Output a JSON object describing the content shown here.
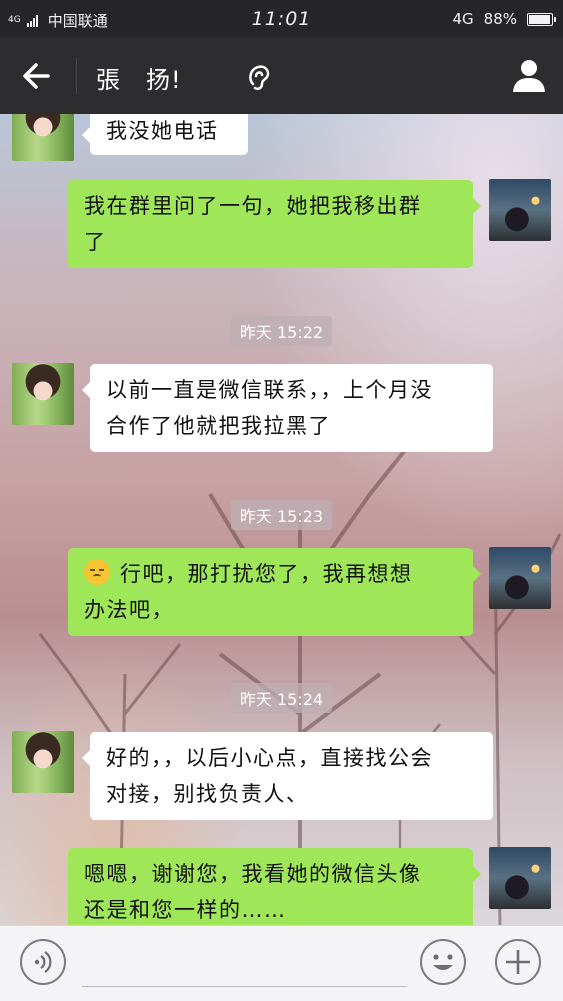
{
  "status_bar": {
    "network_small_top": "4G",
    "carrier": "中国联通",
    "time": "11:01",
    "network": "4G",
    "battery": "88%",
    "battery_level": 0.88
  },
  "nav": {
    "title": "張　扬!"
  },
  "messages": [
    {
      "side": "left",
      "text": "我没她电话"
    },
    {
      "side": "right",
      "text_lines": [
        "我在群里问了一句，她把我移出群",
        "了"
      ]
    },
    {
      "timestamp": "昨天 15:22"
    },
    {
      "side": "left",
      "text_lines": [
        "以前一直是微信联系，，上个月没",
        "合作了他就把我拉黑了"
      ]
    },
    {
      "timestamp": "昨天 15:23"
    },
    {
      "side": "right",
      "emoji": "pensive-face-emoji",
      "text_lines": [
        "行吧，那打扰您了，我再想想",
        "办法吧，"
      ]
    },
    {
      "timestamp": "昨天 15:24"
    },
    {
      "side": "left",
      "text_lines": [
        "好的，，以后小心点，直接找公会",
        "对接，别找负责人、"
      ]
    },
    {
      "side": "right",
      "text_lines": [
        "嗯嗯，谢谢您，我看她的微信头像",
        "还是和您一样的……"
      ]
    }
  ],
  "icons": {
    "back": "back-arrow-icon",
    "ear": "ear-icon",
    "contact": "person-icon",
    "voice": "voice-icon",
    "emoji": "emoji-icon",
    "plus": "plus-icon"
  },
  "colors": {
    "green_bubble": "#9fe659",
    "white_bubble": "#ffffff",
    "nav_bg": "#2d2d30",
    "status_bg": "#262628"
  }
}
